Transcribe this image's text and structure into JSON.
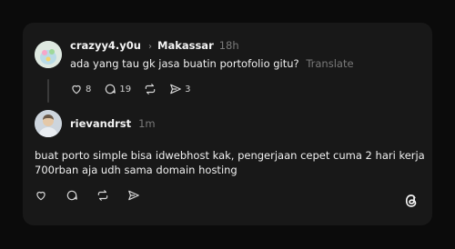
{
  "post": {
    "username": "crazyy4.y0u",
    "location": "Makassar",
    "time": "18h",
    "text": "ada yang tau gk jasa buatin portofolio gitu?",
    "translate_label": "Translate",
    "likes": "8",
    "comments": "19",
    "shares": "3"
  },
  "reply": {
    "username": "rievandrst",
    "time": "1m",
    "text_line1": "buat porto simple bisa idwebhost kak, pengerjaan cepet cuma 2 hari kerja",
    "text_line2": "700rban aja udh sama domain hosting"
  },
  "colors": {
    "background": "#0b0b0b",
    "card": "#181818",
    "text": "#f3f3f3",
    "muted": "#7a7a7a"
  },
  "icons": [
    "chevron-right-icon",
    "heart-icon",
    "comment-icon",
    "repost-icon",
    "share-icon",
    "threads-logo-icon"
  ]
}
